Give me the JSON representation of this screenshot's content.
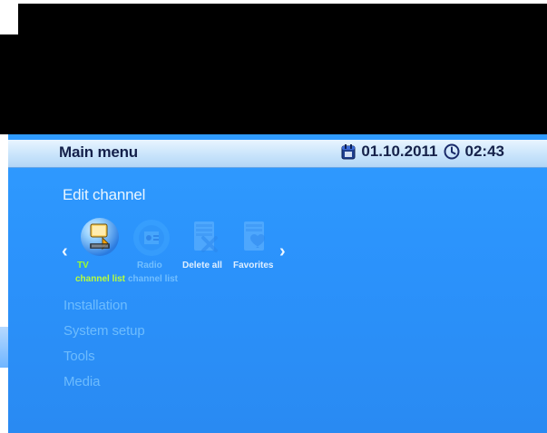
{
  "header": {
    "title": "Main menu",
    "date": "01.10.2011",
    "time": "02:43"
  },
  "main": {
    "section_title": "Edit channel",
    "nav": {
      "left_arrow": "‹",
      "right_arrow": "›"
    },
    "tiles": [
      {
        "line1": "TV",
        "line2": "channel list",
        "icon": "tv-channel-list-icon",
        "selected": true,
        "color_line1": "#9cff2b",
        "color_line2": "#b8ff3b"
      },
      {
        "line1": "Radio",
        "line2": "channel list",
        "icon": "radio-channel-list-icon",
        "selected": false
      },
      {
        "line1": "Delete all",
        "line2": "",
        "icon": "delete-all-icon",
        "selected": false
      },
      {
        "line1": "Favorites",
        "line2": "",
        "icon": "favorites-icon",
        "selected": false
      }
    ],
    "menu_items": [
      {
        "label": "Installation"
      },
      {
        "label": "System setup"
      },
      {
        "label": "Tools"
      },
      {
        "label": "Media"
      }
    ]
  }
}
